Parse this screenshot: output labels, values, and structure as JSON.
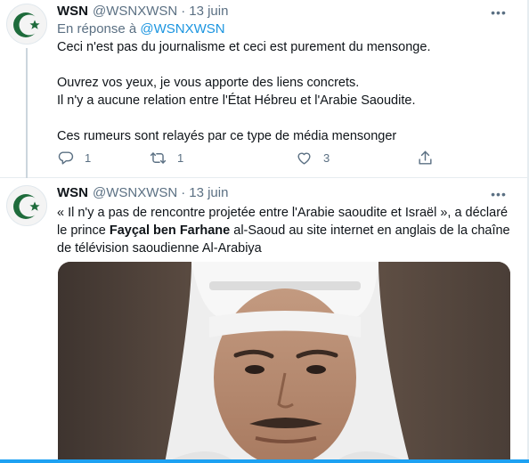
{
  "colors": {
    "accent": "#1da1f2",
    "link": "#1b95e0",
    "muted": "#5b7083",
    "logo_green": "#1e6b3b"
  },
  "tweets": [
    {
      "name": "WSN",
      "handle": "@WSNXWSN",
      "separator": "·",
      "date": "13 juin",
      "reply_prefix": "En réponse à",
      "reply_handle": "@WSNXWSN",
      "lines": [
        "Ceci n'est pas du journalisme et ceci est purement du mensonge.",
        "Ouvrez vos yeux, je vous apporte des liens concrets.",
        "Il n'y a aucune relation entre l'État Hébreu et l'Arabie Saoudite.",
        "Ces rumeurs sont relayés par ce type de média mensonger"
      ],
      "actions": {
        "replies": "1",
        "retweets": "1",
        "likes": "3"
      }
    },
    {
      "name": "WSN",
      "handle": "@WSNXWSN",
      "separator": "·",
      "date": "13 juin",
      "text_before": "« Il n'y a pas de rencontre projetée entre l'Arabie saoudite et Israël », a déclaré le prince ",
      "text_bold": "Fayçal ben Farhane",
      "text_after": " al-Saoud au site internet en anglais de la chaîne de télévision saoudienne Al-Arabiya",
      "media": "photo-of-prince"
    }
  ],
  "icons": [
    "crescent-star-avatar-icon",
    "more-icon",
    "reply-icon",
    "retweet-icon",
    "like-icon",
    "share-icon"
  ]
}
